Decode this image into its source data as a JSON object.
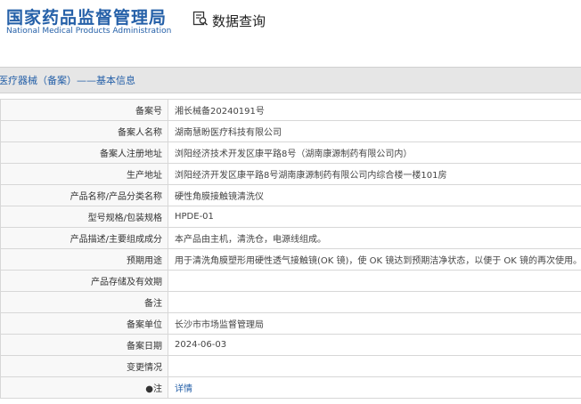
{
  "header": {
    "logo_cn": "国家药品监督管理局",
    "logo_en": "National Medical Products Administration",
    "nav_label": "数据查询",
    "nav_icon": "search-data-icon"
  },
  "section": {
    "title": "医疗器械（备案）——基本信息"
  },
  "rows": [
    {
      "label": "备案号",
      "value": "湘长械备20240191号"
    },
    {
      "label": "备案人名称",
      "value": "湖南慧盼医疗科技有限公司"
    },
    {
      "label": "备案人注册地址",
      "value": "浏阳经济技术开发区康平路8号（湖南康源制药有限公司内）"
    },
    {
      "label": "生产地址",
      "value": "浏阳经济开发区康平路8号湖南康源制药有限公司内综合楼一楼101房"
    },
    {
      "label": "产品名称/产品分类名称",
      "value": "硬性角膜接触镜清洗仪"
    },
    {
      "label": "型号规格/包装规格",
      "value": "HPDE-01"
    },
    {
      "label": "产品描述/主要组成成分",
      "value": "本产品由主机，清洗仓，电源线组成。"
    },
    {
      "label": "预期用途",
      "value": "用于清洗角膜塑形用硬性透气接触镜(OK 镜)，使 OK 镜达到预期洁净状态，以便于 OK 镜的再次使用。"
    },
    {
      "label": "产品存储及有效期",
      "value": ""
    },
    {
      "label": "备注",
      "value": ""
    },
    {
      "label": "备案单位",
      "value": "长沙市市场监督管理局"
    },
    {
      "label": "备案日期",
      "value": "2024-06-03"
    },
    {
      "label": "变更情况",
      "value": ""
    },
    {
      "label": "●注",
      "value": "详情"
    }
  ]
}
